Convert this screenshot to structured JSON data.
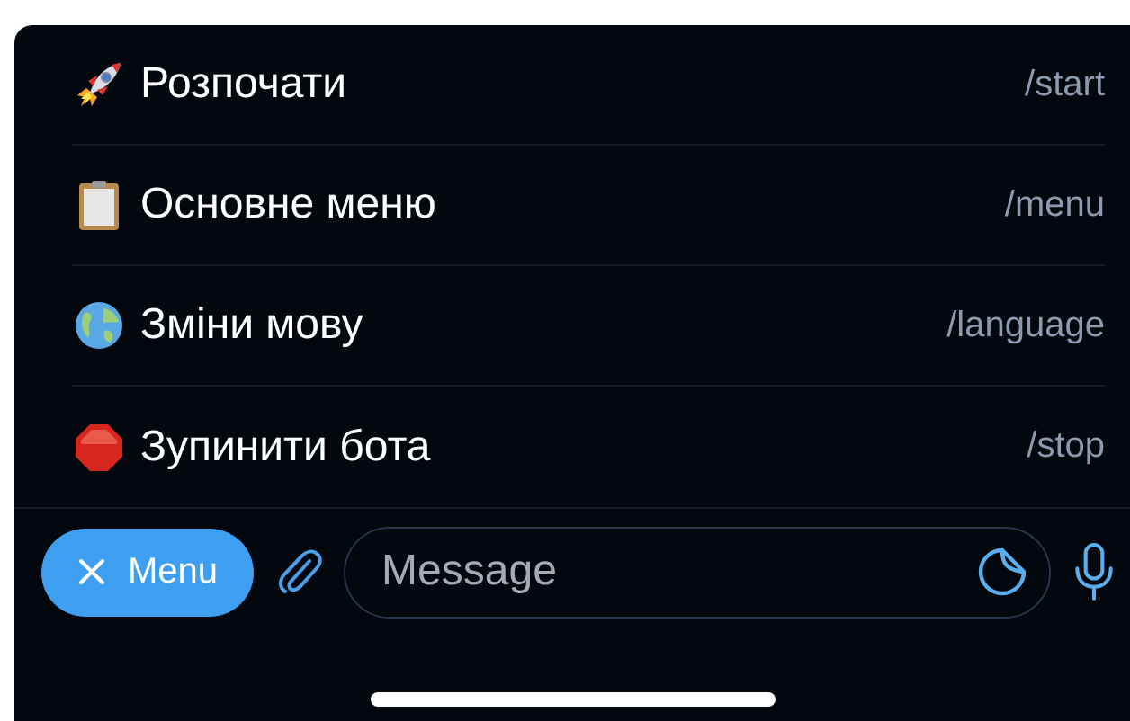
{
  "commands": [
    {
      "label": "Розпочати",
      "command": "/start",
      "kind": "rocket"
    },
    {
      "label": "Основне меню",
      "command": "/menu",
      "kind": "clipboard"
    },
    {
      "label": "Зміни мову",
      "command": "/language",
      "kind": "globe"
    },
    {
      "label": "Зупинити бота",
      "command": "/stop",
      "kind": "stop"
    }
  ],
  "composer": {
    "menu_button": "Menu",
    "placeholder": "Message"
  }
}
